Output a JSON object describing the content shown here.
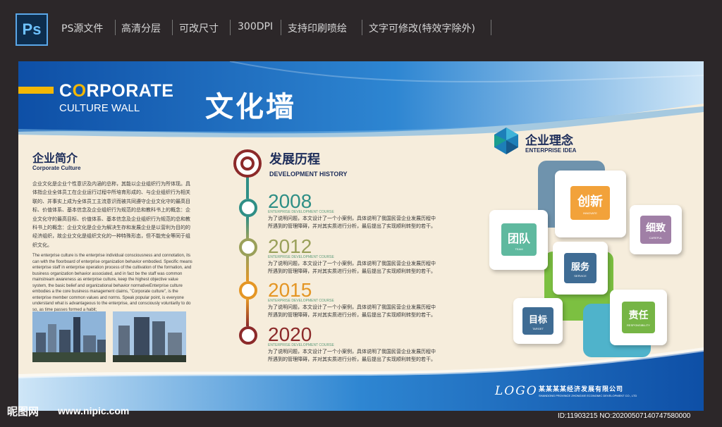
{
  "topbar": {
    "app_icon_text": "Ps",
    "features": [
      "PS源文件",
      "高清分层",
      "可改尺寸",
      "300DPI",
      "支持印刷喷绘",
      "文字可修改(特效字除外)"
    ]
  },
  "header": {
    "corporate_c": "C",
    "corporate_o": "O",
    "corporate_rest": "RPORATE",
    "culture_wall": "CULTURE WALL",
    "calligraphy": "文化墙"
  },
  "intro": {
    "title": "企业简介",
    "subtitle": "Corporate Culture",
    "cn_paragraph": "企业文化是企业个性意识及内涵的总称，其能以企业组织行为所体现。具体指企业全体员工在企业运行过程中所培育形成的、与企业组织行为相关联的、并事实上成为全体员工主流意识而被共同遵守企业文化守的最高目标、价值体系、基本信念及企业组织行为规范的总和教科书上的概念：企业文化守的最高目标、价值体系、基本信念及企业组织行为规范的总和教科书上的概念：企业文化是企业为解决生存和发展企业是以营利为目的的经济组织，故企业文化是组织文化的一种特殊形态，但不能完全等同于组织文化。",
    "en_paragraph": "The enterprise culture is the enterprise individual consciousness and connotation, its can with the floorboard of enterprise organization behavior embodied. Specific means enterprise staff in enterprise operation process of the cultivation of the formation, and business organization behavior associated, and in fact be the staff was common mainstream awareness as enterprise culture, keep the highest objective value system, the basic belief and organizational behavior normativeEnterprise culture embodies a the core business management claims, \"Corporate culture\", is the enterprise member common values and norms. Speak popular point, is everyone understand what is advantageous to the enterprise, and consciously voluntarily to do so, as time passes formed a habit;"
  },
  "history": {
    "title": "发展历程",
    "subtitle": "DEVELOPMENT HISTORY",
    "entries": [
      {
        "year": "2008",
        "sub": "ENTERPRISE DEVELOPMENT COURSE",
        "line1": "为了说明问题，本文设计了一个小案例，具体说明了我国民营企业发展历程中",
        "line2": "所遇到的管理障碍，并对其实质进行分析，最后提出了实现顺利转型的若干。"
      },
      {
        "year": "2012",
        "sub": "ENTERPRISE DEVELOPMENT COURSE",
        "line1": "为了说明问题，本文设计了一个小案例，具体说明了我国民营企业发展历程中",
        "line2": "所遇到的管理障碍，并对其实质进行分析，最后提出了实现顺利转型的若干。"
      },
      {
        "year": "2015",
        "sub": "ENTERPRISE DEVELOPMENT COURSE",
        "line1": "为了说明问题，本文设计了一个小案例，具体说明了我国民营企业发展历程中",
        "line2": "所遇到的管理障碍，并对其实质进行分析，最后提出了实现顺利转型的若干。"
      },
      {
        "year": "2020",
        "sub": "ENTERPRISE DEVELOPMENT COURSE",
        "line1": "为了说明问题，本文设计了一个小案例，具体说明了我国民营企业发展历程中",
        "line2": "所遇到的管理障碍，并对其实质进行分析，最后提出了实现顺利转型的若干。"
      }
    ],
    "colors": [
      "#2f8f86",
      "#9aa05a",
      "#e49625",
      "#8c2a2a"
    ]
  },
  "idea": {
    "title": "企业理念",
    "subtitle": "ENTERPRISE IDEA",
    "tiles": {
      "innovate": {
        "cn": "创新",
        "en": "INNOVATE",
        "color": "#f2a23a"
      },
      "team": {
        "cn": "团队",
        "en": "TEAM",
        "color": "#5fb99f"
      },
      "careful": {
        "cn": "细致",
        "en": "CAREFUL",
        "color": "#a07fa6"
      },
      "service": {
        "cn": "服务",
        "en": "SERVICE",
        "color": "#3f6c94"
      },
      "target": {
        "cn": "目标",
        "en": "TARGET",
        "color": "#3f6c94"
      },
      "responsibility": {
        "cn": "责任",
        "en": "RESPONSIBILITY",
        "color": "#76b545"
      }
    }
  },
  "footer": {
    "logo": "LOGO",
    "company": "某某某某经济发展有限公司",
    "company_en": "SHANDONG PROVINCE ZHONGXIE ECONOMIC DEVELOPMENT CO., LTD"
  },
  "watermark": {
    "site_cn": "昵图网",
    "site_url": "www.nipic.com",
    "id_text": "ID:11903215 NO:20200507140747580000"
  }
}
